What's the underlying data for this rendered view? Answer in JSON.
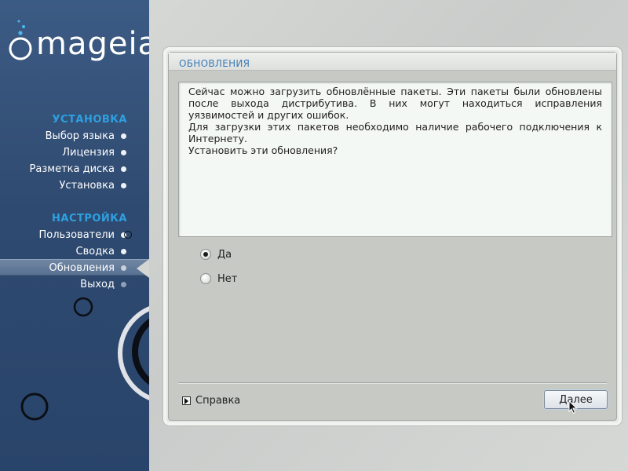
{
  "brand": {
    "name": "mageia"
  },
  "sidebar": {
    "sections": [
      {
        "title": "УСТАНОВКА",
        "steps": [
          {
            "label": "Выбор языка"
          },
          {
            "label": "Лицензия"
          },
          {
            "label": "Разметка диска"
          },
          {
            "label": "Установка"
          }
        ]
      },
      {
        "title": "НАСТРОЙКА",
        "steps": [
          {
            "label": "Пользователи"
          },
          {
            "label": "Сводка"
          },
          {
            "label": "Обновления"
          },
          {
            "label": "Выход"
          }
        ]
      }
    ],
    "current_step": "Обновления"
  },
  "dialog": {
    "title": "ОБНОВЛЕНИЯ",
    "message": {
      "line1": "Сейчас можно загрузить обновлённые пакеты. Эти пакеты были обновлены после выхода дистрибутива. В них могут находиться исправления уязвимостей и других ошибок.",
      "line2": "Для загрузки этих пакетов необходимо наличие рабочего подключения к Интернету.",
      "line3": "Установить эти обновления?"
    },
    "options": [
      {
        "label": "Да",
        "selected": true
      },
      {
        "label": "Нет",
        "selected": false
      }
    ],
    "help_label": "Справка",
    "next_label": "Далее"
  },
  "colors": {
    "sidebar_bg": "#2f4a70",
    "section_title": "#2ea0e0",
    "dialog_title": "#3d7ab8"
  }
}
